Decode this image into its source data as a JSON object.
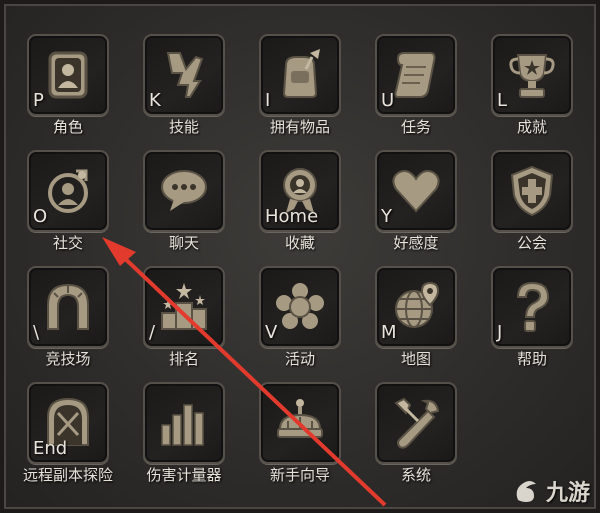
{
  "menu": {
    "items": [
      {
        "key": "P",
        "label": "角色",
        "icon": "character-portrait-icon"
      },
      {
        "key": "K",
        "label": "技能",
        "icon": "skill-lightning-icon"
      },
      {
        "key": "I",
        "label": "拥有物品",
        "icon": "inventory-bag-icon"
      },
      {
        "key": "U",
        "label": "任务",
        "icon": "quest-scroll-icon"
      },
      {
        "key": "L",
        "label": "成就",
        "icon": "achievement-trophy-icon"
      },
      {
        "key": "O",
        "label": "社交",
        "icon": "social-person-icon"
      },
      {
        "key": "",
        "label": "聊天",
        "icon": "chat-bubble-icon"
      },
      {
        "key": "Home",
        "label": "收藏",
        "icon": "collection-medal-icon"
      },
      {
        "key": "Y",
        "label": "好感度",
        "icon": "affection-heart-icon"
      },
      {
        "key": "",
        "label": "公会",
        "icon": "guild-shield-icon"
      },
      {
        "key": "\\",
        "label": "竞技场",
        "icon": "arena-arch-icon"
      },
      {
        "key": "/",
        "label": "排名",
        "icon": "ranking-podium-icon"
      },
      {
        "key": "V",
        "label": "活动",
        "icon": "event-star-icon"
      },
      {
        "key": "M",
        "label": "地图",
        "icon": "map-globe-icon"
      },
      {
        "key": "J",
        "label": "帮助",
        "icon": "help-question-icon"
      },
      {
        "key": "End",
        "label": "远程副本探险",
        "icon": "dungeon-gate-icon"
      },
      {
        "key": "",
        "label": "伤害计量器",
        "icon": "damage-meter-bars-icon"
      },
      {
        "key": "",
        "label": "新手向导",
        "icon": "beginner-crown-icon"
      },
      {
        "key": "",
        "label": "系统",
        "icon": "system-wrench-icon"
      }
    ]
  },
  "watermark": {
    "text": "九游",
    "icon": "jiuyou-logo-icon"
  },
  "colors": {
    "arrow": "#e23b2e",
    "icon": "#b8ad98",
    "label": "#e6e2da"
  }
}
